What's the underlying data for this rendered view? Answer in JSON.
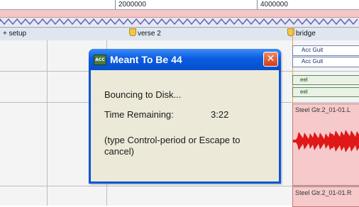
{
  "ruler": {
    "marks": [
      "2000000",
      "4000000"
    ]
  },
  "markers": [
    {
      "name": "+ setup",
      "has_pin": false
    },
    {
      "name": "verse 2",
      "has_pin": true
    },
    {
      "name": "bridge",
      "has_pin": true
    }
  ],
  "clips": {
    "midi_a": "Acc Guit",
    "midi_b": "Acc Guit",
    "green_a": "eel",
    "green_b": "eel"
  },
  "audio_regions": [
    {
      "name": "Steel Gtr.2_01-01.L"
    },
    {
      "name": "Steel Gtr.2_01-01.R"
    }
  ],
  "dialog": {
    "title": "Meant To Be 44",
    "icon": "app-icon",
    "close_icon": "close-icon",
    "status": "Bouncing to Disk...",
    "time_label": "Time Remaining:",
    "time_value": "3:22",
    "hint": "(type Control-period or Escape to cancel)"
  },
  "colors": {
    "dialog_title_bar": "#0a56d8",
    "dialog_body": "#ece9d8",
    "close_button": "#d6492a",
    "audio_region": "#f6caca",
    "waveform": "#e01818",
    "conductor_track": "#f4c6c6"
  }
}
